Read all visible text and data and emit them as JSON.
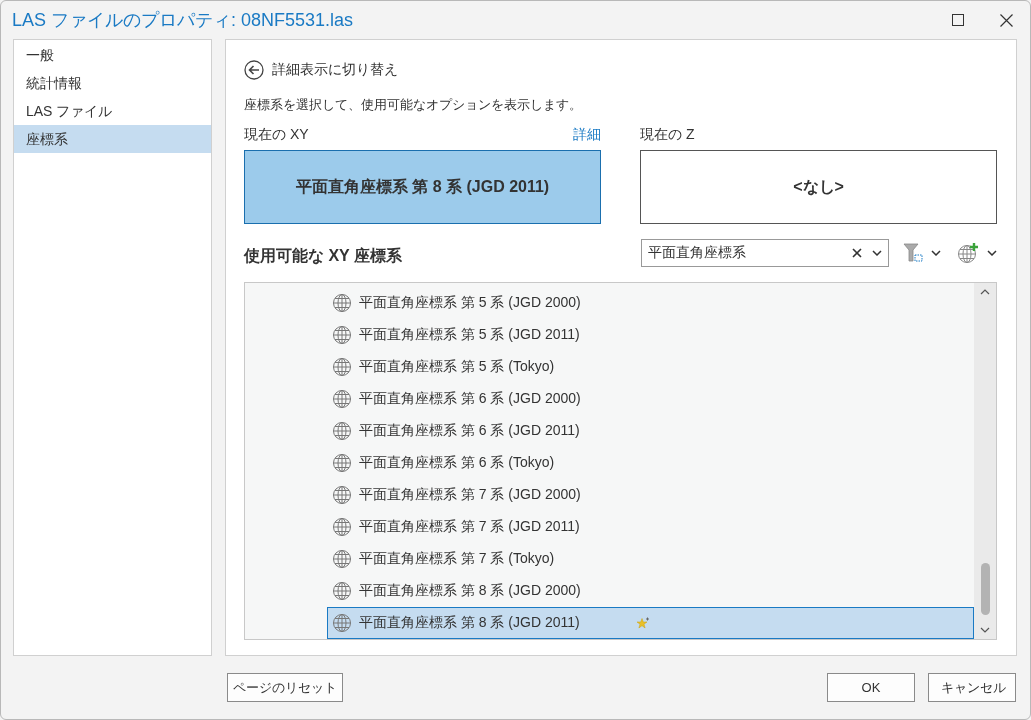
{
  "window": {
    "title": "LAS ファイルのプロパティ: 08NF5531.las"
  },
  "sidebar": {
    "items": [
      {
        "label": "一般",
        "selected": false
      },
      {
        "label": "統計情報",
        "selected": false
      },
      {
        "label": "LAS ファイル",
        "selected": false
      },
      {
        "label": "座標系",
        "selected": true
      }
    ]
  },
  "back_link": "詳細表示に切り替え",
  "description": "座標系を選択して、使用可能なオプションを表示します。",
  "current_xy": {
    "label": "現在の XY",
    "details_link": "詳細",
    "value": "平面直角座標系 第 8 系 (JGD 2011)"
  },
  "current_z": {
    "label": "現在の Z",
    "value": "<なし>"
  },
  "available": {
    "heading": "使用可能な XY 座標系",
    "search": {
      "value": "平面直角座標系"
    },
    "items": [
      {
        "label": "平面直角座標系 第 5 系 (JGD 2000)",
        "selected": false,
        "favorite": false
      },
      {
        "label": "平面直角座標系 第 5 系 (JGD 2011)",
        "selected": false,
        "favorite": false
      },
      {
        "label": "平面直角座標系 第 5 系 (Tokyo)",
        "selected": false,
        "favorite": false
      },
      {
        "label": "平面直角座標系 第 6 系 (JGD 2000)",
        "selected": false,
        "favorite": false
      },
      {
        "label": "平面直角座標系 第 6 系 (JGD 2011)",
        "selected": false,
        "favorite": false
      },
      {
        "label": "平面直角座標系 第 6 系 (Tokyo)",
        "selected": false,
        "favorite": false
      },
      {
        "label": "平面直角座標系 第 7 系 (JGD 2000)",
        "selected": false,
        "favorite": false
      },
      {
        "label": "平面直角座標系 第 7 系 (JGD 2011)",
        "selected": false,
        "favorite": false
      },
      {
        "label": "平面直角座標系 第 7 系 (Tokyo)",
        "selected": false,
        "favorite": false
      },
      {
        "label": "平面直角座標系 第 8 系 (JGD 2000)",
        "selected": false,
        "favorite": false
      },
      {
        "label": "平面直角座標系 第 8 系 (JGD 2011)",
        "selected": true,
        "favorite": true
      }
    ]
  },
  "buttons": {
    "reset": "ページのリセット",
    "ok": "OK",
    "cancel": "キャンセル"
  }
}
